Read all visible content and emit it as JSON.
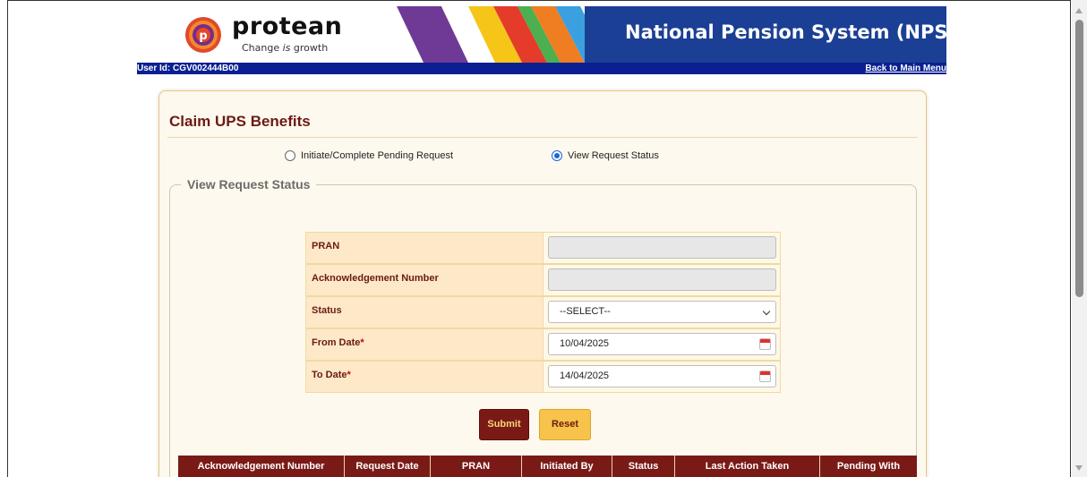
{
  "header": {
    "logo_text": "protean",
    "logo_tagline_prefix": "Change ",
    "logo_tagline_is": "is",
    "logo_tagline_suffix": " growth",
    "title": "National Pension System (NPS)"
  },
  "userbar": {
    "user_id": "User Id: CGV002444B00",
    "back_link": "Back to Main Menu"
  },
  "panel": {
    "title": "Claim UPS Benefits",
    "radio_options": [
      {
        "label": "Initiate/Complete Pending Request",
        "checked": false
      },
      {
        "label": "View Request Status",
        "checked": true
      }
    ],
    "fieldset_legend": "View Request Status"
  },
  "form": {
    "pran_label": "PRAN",
    "pran_value": "",
    "ack_label": "Acknowledgement Number",
    "ack_value": "",
    "status_label": "Status",
    "status_selected": "--SELECT--",
    "from_date_label": "From Date",
    "from_date_value": "10/04/2025",
    "to_date_label": "To Date",
    "to_date_value": "14/04/2025",
    "required_mark": "*"
  },
  "buttons": {
    "submit": "Submit",
    "reset": "Reset"
  },
  "results_table": {
    "columns": [
      "Acknowledgement Number",
      "Request Date",
      "PRAN",
      "Initiated By",
      "Status",
      "Last Action Taken",
      "Pending With"
    ]
  },
  "colors": {
    "brand_navy": "#1b3f94",
    "maroon": "#7a1a16",
    "gold": "#f7c34a"
  }
}
